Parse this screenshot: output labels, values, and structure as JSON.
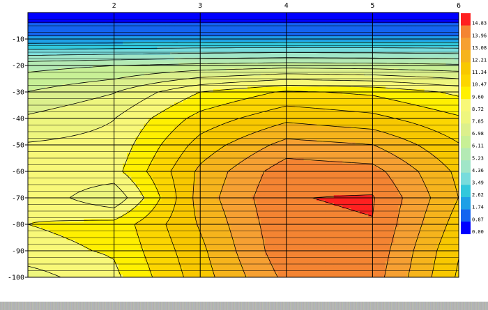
{
  "chart_data": {
    "type": "heatmap",
    "title": "",
    "xlabel": "",
    "ylabel": "",
    "x_ticks": [
      2,
      3,
      4,
      5,
      6
    ],
    "y_ticks": [
      -10,
      -20,
      -30,
      -40,
      -50,
      -60,
      -70,
      -80,
      -90,
      -100
    ],
    "xlim": [
      1,
      6
    ],
    "ylim": [
      -100,
      0
    ],
    "grid": true,
    "x": [
      1,
      2,
      3,
      4,
      5,
      6
    ],
    "y": [
      -100,
      -90,
      -80,
      -70,
      -60,
      -50,
      -40,
      -30,
      -20,
      -10,
      0
    ],
    "z": [
      [
        8.3,
        9.4,
        11.8,
        14.2,
        14.4,
        11.2
      ],
      [
        9.3,
        9.7,
        12.0,
        14.6,
        14.6,
        11.4
      ],
      [
        9.6,
        9.9,
        12.3,
        14.7,
        14.8,
        11.8
      ],
      [
        9.4,
        8.0,
        12.6,
        14.8,
        14.9,
        12.2
      ],
      [
        9.2,
        9.3,
        12.4,
        14.5,
        14.3,
        12.0
      ],
      [
        8.8,
        9.0,
        11.7,
        13.4,
        13.1,
        11.4
      ],
      [
        8.0,
        8.7,
        10.8,
        12.0,
        11.6,
        10.6
      ],
      [
        7.0,
        7.8,
        9.6,
        10.6,
        10.3,
        9.4
      ],
      [
        5.8,
        6.1,
        6.4,
        6.6,
        6.5,
        6.3
      ],
      [
        2.0,
        2.0,
        2.0,
        2.0,
        2.0,
        2.0
      ],
      [
        0.2,
        0.2,
        0.2,
        0.2,
        0.2,
        0.2
      ]
    ],
    "colorbar": {
      "levels": [
        "0.00",
        "0.87",
        "1.74",
        "2.62",
        "3.49",
        "4.36",
        "5.23",
        "6.11",
        "6.98",
        "7.85",
        "8.72",
        "9.60",
        "10.47",
        "11.34",
        "12.21",
        "13.08",
        "13.96",
        "14.83"
      ],
      "colors": [
        "#0000ff",
        "#1464f0",
        "#1ea0e6",
        "#32c8dc",
        "#78dcdc",
        "#a0e6c8",
        "#b4eab4",
        "#c8f096",
        "#dcf08c",
        "#eef67e",
        "#f8f878",
        "#fff000",
        "#fcd600",
        "#f8c800",
        "#f6b41c",
        "#f6a032",
        "#f48432",
        "#ff2020"
      ]
    }
  }
}
